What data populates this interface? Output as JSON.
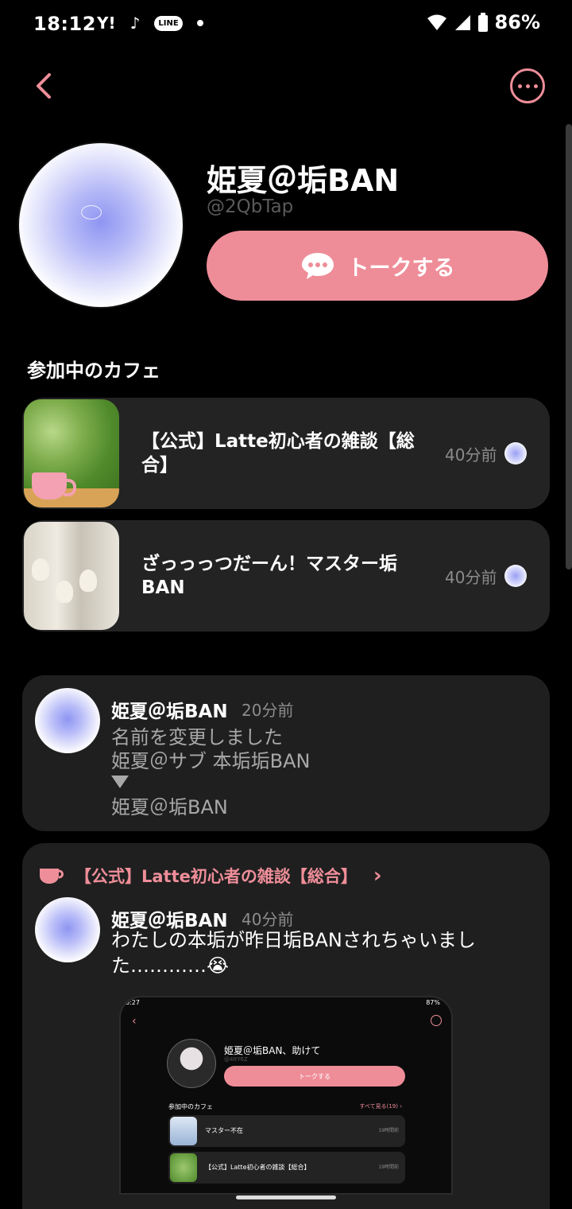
{
  "status": {
    "time": "18:12",
    "yahoo": "Y!",
    "tiktok": "♪",
    "line": "LINE",
    "battery": "86%"
  },
  "profile": {
    "name": "姫夏＠垢BAN",
    "handle": "@2QbTap",
    "talk_label": "トークする"
  },
  "cafes_section": {
    "title": "参加中のカフェ"
  },
  "cafes": [
    {
      "title": "【公式】Latte初心者の雑談【総合】",
      "time": "40分前"
    },
    {
      "title": "ざっっっつだーん！マスター垢BAN",
      "time": "40分前"
    }
  ],
  "post1": {
    "name": "姫夏＠垢BAN",
    "time": "20分前",
    "line1": "名前を変更しました",
    "line2": "姫夏＠サブ 本垢垢BAN",
    "line3": "姫夏＠垢BAN"
  },
  "post2": {
    "cafe": "【公式】Latte初心者の雑談【総合】",
    "name": "姫夏＠垢BAN",
    "time": "40分前",
    "body": "わたしの本垢が昨日垢BANされちゃいました…………😭",
    "shot": {
      "time": "6:27",
      "battery": "87%",
      "name": "姫夏＠垢BAN、助けて",
      "handle": "@4ItY6Z",
      "talk_label": "トークする",
      "section": "参加中のカフェ",
      "see_all": "すべて見る(19) ›",
      "rows": [
        {
          "title": "マスター不在",
          "time": "19時間前"
        },
        {
          "title": "【公式】Latte初心者の雑談【総合】",
          "time": "19時間前"
        }
      ]
    }
  },
  "colors": {
    "accent": "#ee8e99",
    "button": "#ee8d98",
    "card": "#232323",
    "background": "#000000"
  }
}
